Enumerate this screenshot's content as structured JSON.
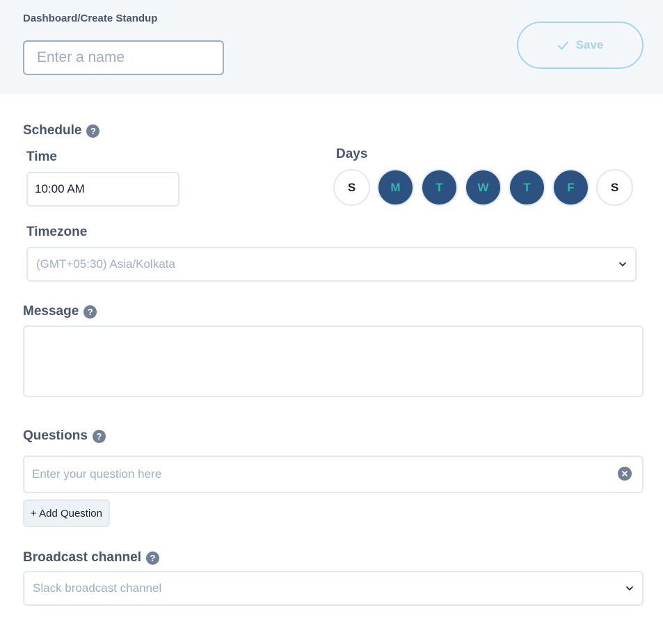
{
  "header": {
    "breadcrumb": "Dashboard/Create Standup",
    "name_placeholder": "Enter a name",
    "save_label": "Save"
  },
  "schedule": {
    "label": "Schedule",
    "time_label": "Time",
    "time_value": "10:00 AM",
    "days_label": "Days",
    "days": [
      {
        "letter": "S",
        "selected": false
      },
      {
        "letter": "M",
        "selected": true
      },
      {
        "letter": "T",
        "selected": true
      },
      {
        "letter": "W",
        "selected": true
      },
      {
        "letter": "T",
        "selected": true
      },
      {
        "letter": "F",
        "selected": true
      },
      {
        "letter": "S",
        "selected": false
      }
    ],
    "timezone_label": "Timezone",
    "timezone_value": "(GMT+05:30) Asia/Kolkata"
  },
  "message": {
    "label": "Message",
    "value": ""
  },
  "questions": {
    "label": "Questions",
    "placeholder": "Enter your question here",
    "add_label": "+ Add Question"
  },
  "broadcast": {
    "label": "Broadcast channel",
    "placeholder": "Slack broadcast channel"
  },
  "colors": {
    "selected_day_bg": "#2c5282",
    "selected_day_text": "#38b2ac",
    "save_accent": "#a8d4ea",
    "header_bg": "#f4f7fa"
  },
  "icons": {
    "help": "question-circle-icon",
    "save": "check-icon",
    "clear": "x-circle-icon",
    "dropdown": "chevron-down-icon"
  }
}
